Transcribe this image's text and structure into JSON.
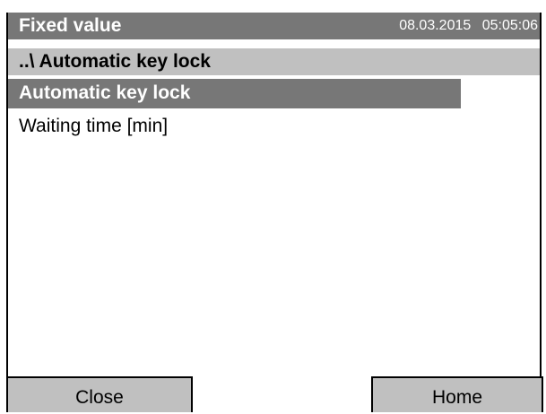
{
  "header": {
    "title": "Fixed value",
    "date": "08.03.2015",
    "time": "05:05:06"
  },
  "breadcrumb": {
    "path": "..\\ Automatic key lock"
  },
  "menu": {
    "items": [
      {
        "label": "Automatic key lock",
        "selected": true
      },
      {
        "label": "Waiting time [min]",
        "selected": false
      }
    ]
  },
  "footer": {
    "close_label": "Close",
    "home_label": "Home"
  },
  "colors": {
    "title_bar": "#777777",
    "breadcrumb_bar": "#c0c0c0",
    "selected_row": "#777777",
    "button_bg": "#c0c0c0"
  }
}
